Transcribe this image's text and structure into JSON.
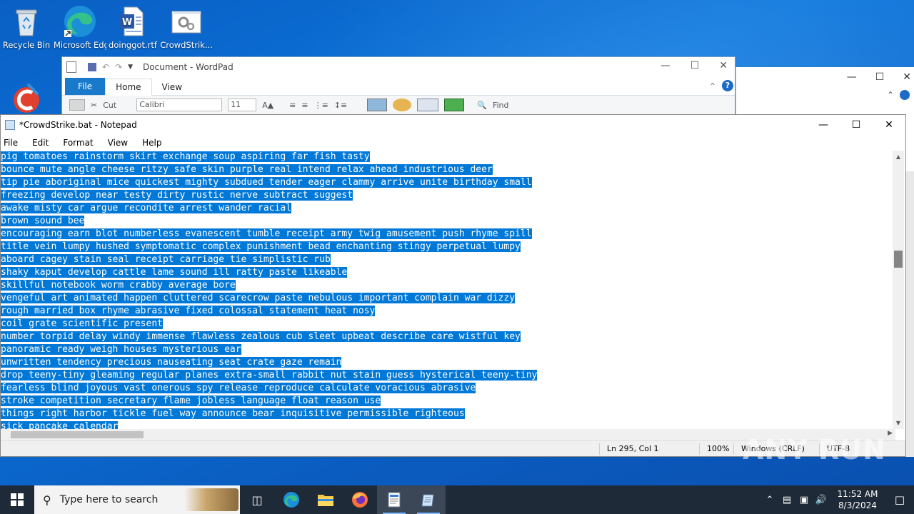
{
  "desktop": {
    "icons": [
      {
        "label": "Recycle Bin",
        "icon": "recycle-bin-icon"
      },
      {
        "label": "Microsoft Edge",
        "icon": "edge-icon"
      },
      {
        "label": "doinggot.rtf",
        "icon": "word-document-icon"
      },
      {
        "label": "CrowdStrik...",
        "icon": "settings-file-icon"
      },
      {
        "label": "",
        "icon": "ccleaner-icon"
      }
    ]
  },
  "wordpad": {
    "title": "Document - WordPad",
    "tabs": [
      "File",
      "Home",
      "View"
    ],
    "ribbon": {
      "cut": "Cut",
      "font": "Calibri",
      "size": "11",
      "find": "Find"
    }
  },
  "notepad": {
    "title": "*CrowdStrike.bat - Notepad",
    "menu": [
      "File",
      "Edit",
      "Format",
      "View",
      "Help"
    ],
    "lines": [
      "pig tomatoes rainstorm skirt exchange soup aspiring far fish tasty",
      "bounce mute angle cheese ritzy safe skin purple real intend relax ahead industrious deer",
      "tip pie aboriginal mice quickest mighty subdued tender eager clammy arrive unite birthday small",
      "freezing develop near testy dirty rustic nerve subtract suggest",
      "awake misty car argue recondite arrest wander racial",
      "brown sound bee",
      "encouraging earn blot numberless evanescent tumble receipt army twig amusement push rhyme spill",
      "title vein lumpy hushed symptomatic complex punishment bead enchanting stingy perpetual lumpy",
      "aboard cagey stain seal receipt carriage tie simplistic rub",
      "shaky kaput develop cattle lame sound ill ratty paste likeable",
      "skillful notebook worm crabby average bore",
      "vengeful art animated happen cluttered scarecrow paste nebulous important complain war dizzy",
      "rough married box rhyme abrasive fixed colossal statement heat nosy",
      "coil grate scientific present",
      "number torpid delay windy immense flawless zealous cub sleet upbeat describe care wistful key",
      "panoramic ready weigh houses mysterious ear",
      "unwritten tendency precious nauseating seat crate gaze remain",
      "drop teeny-tiny gleaming regular planes extra-small rabbit nut stain guess hysterical teeny-tiny",
      "fearless blind joyous vast onerous spy release reproduce calculate voracious abrasive",
      "stroke competition secretary flame jobless language float reason use",
      "things right harbor tickle fuel way announce bear inquisitive permissible righteous",
      "sick pancake calendar"
    ],
    "status": {
      "position": "Ln 295, Col 1",
      "zoom": "100%",
      "line_ending": "Windows (CRLF)",
      "encoding": "UTF-8"
    },
    "selection_color": "#0078d7"
  },
  "watermark": "ANY RUN",
  "taskbar": {
    "search_placeholder": "Type here to search",
    "apps": [
      "task-view-icon",
      "edge-icon",
      "file-explorer-icon",
      "firefox-icon",
      "wordpad-icon",
      "notepad-icon"
    ],
    "time": "11:52 AM",
    "date": "8/3/2024"
  }
}
